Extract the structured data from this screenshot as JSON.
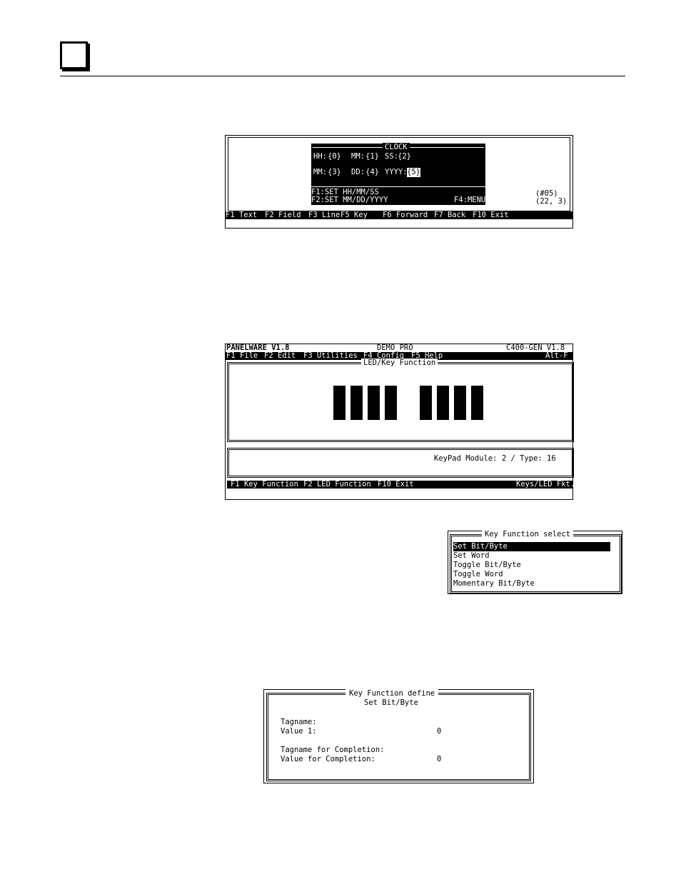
{
  "screen1": {
    "clock_title": "CLOCK",
    "row1": {
      "hh_label": "HH:",
      "hh_field": "{0}",
      "mm_label": "MM:",
      "mm_field": "{1}",
      "ss_label": "SS:",
      "ss_field": "{2}"
    },
    "row2": {
      "mm_label": "MM:",
      "mm_field": "{3}",
      "dd_label": "DD:",
      "dd_field": "{4}",
      "yyyy_label": "YYYY:",
      "yyyy_field": "{5}"
    },
    "hint1": "F1:SET HH/MM/SS",
    "hint2": "F2:SET MM/DD/YYYY",
    "hint_f4": "F4:MENU",
    "field_id": "(#05)",
    "cursor_pos": "(22, 3)",
    "status_bar": [
      "F1 Text",
      "F2 Field",
      "F3 Line",
      "F5 Key",
      "F6 Forward",
      "F7 Back",
      "F10 Exit"
    ]
  },
  "screen2": {
    "app_name": "PANELWARE V1.8",
    "project": "DEMO_PRO",
    "target": "C400-GEN V1.8",
    "menu": [
      "F1 File",
      "F2 Edit",
      "F3 Utilities",
      "F4 Config",
      "F5 Help"
    ],
    "menu_shortcut": "Alt-F",
    "led_box_title": "LED/Key Function",
    "keypad_info": "KeyPad Module: 2 / Type: 16",
    "status_bar": [
      "F1 Key Function",
      "F2 LED Function",
      "F10 Exit"
    ],
    "status_right": "Keys/LED Fkt."
  },
  "key_function_select": {
    "title": "Key Function select",
    "items": [
      "Set Bit/Byte",
      "Set Word",
      "Toggle Bit/Byte",
      "Toggle Word",
      "Momentary Bit/Byte"
    ]
  },
  "key_function_define": {
    "title": "Key Function define",
    "subtitle": "Set Bit/Byte",
    "tagname_label": "Tagname:",
    "value1_label": "Value 1:",
    "value1": "0",
    "completion_tag_label": "Tagname for Completion:",
    "completion_value_label": "Value for Completion:",
    "completion_value": "0"
  }
}
